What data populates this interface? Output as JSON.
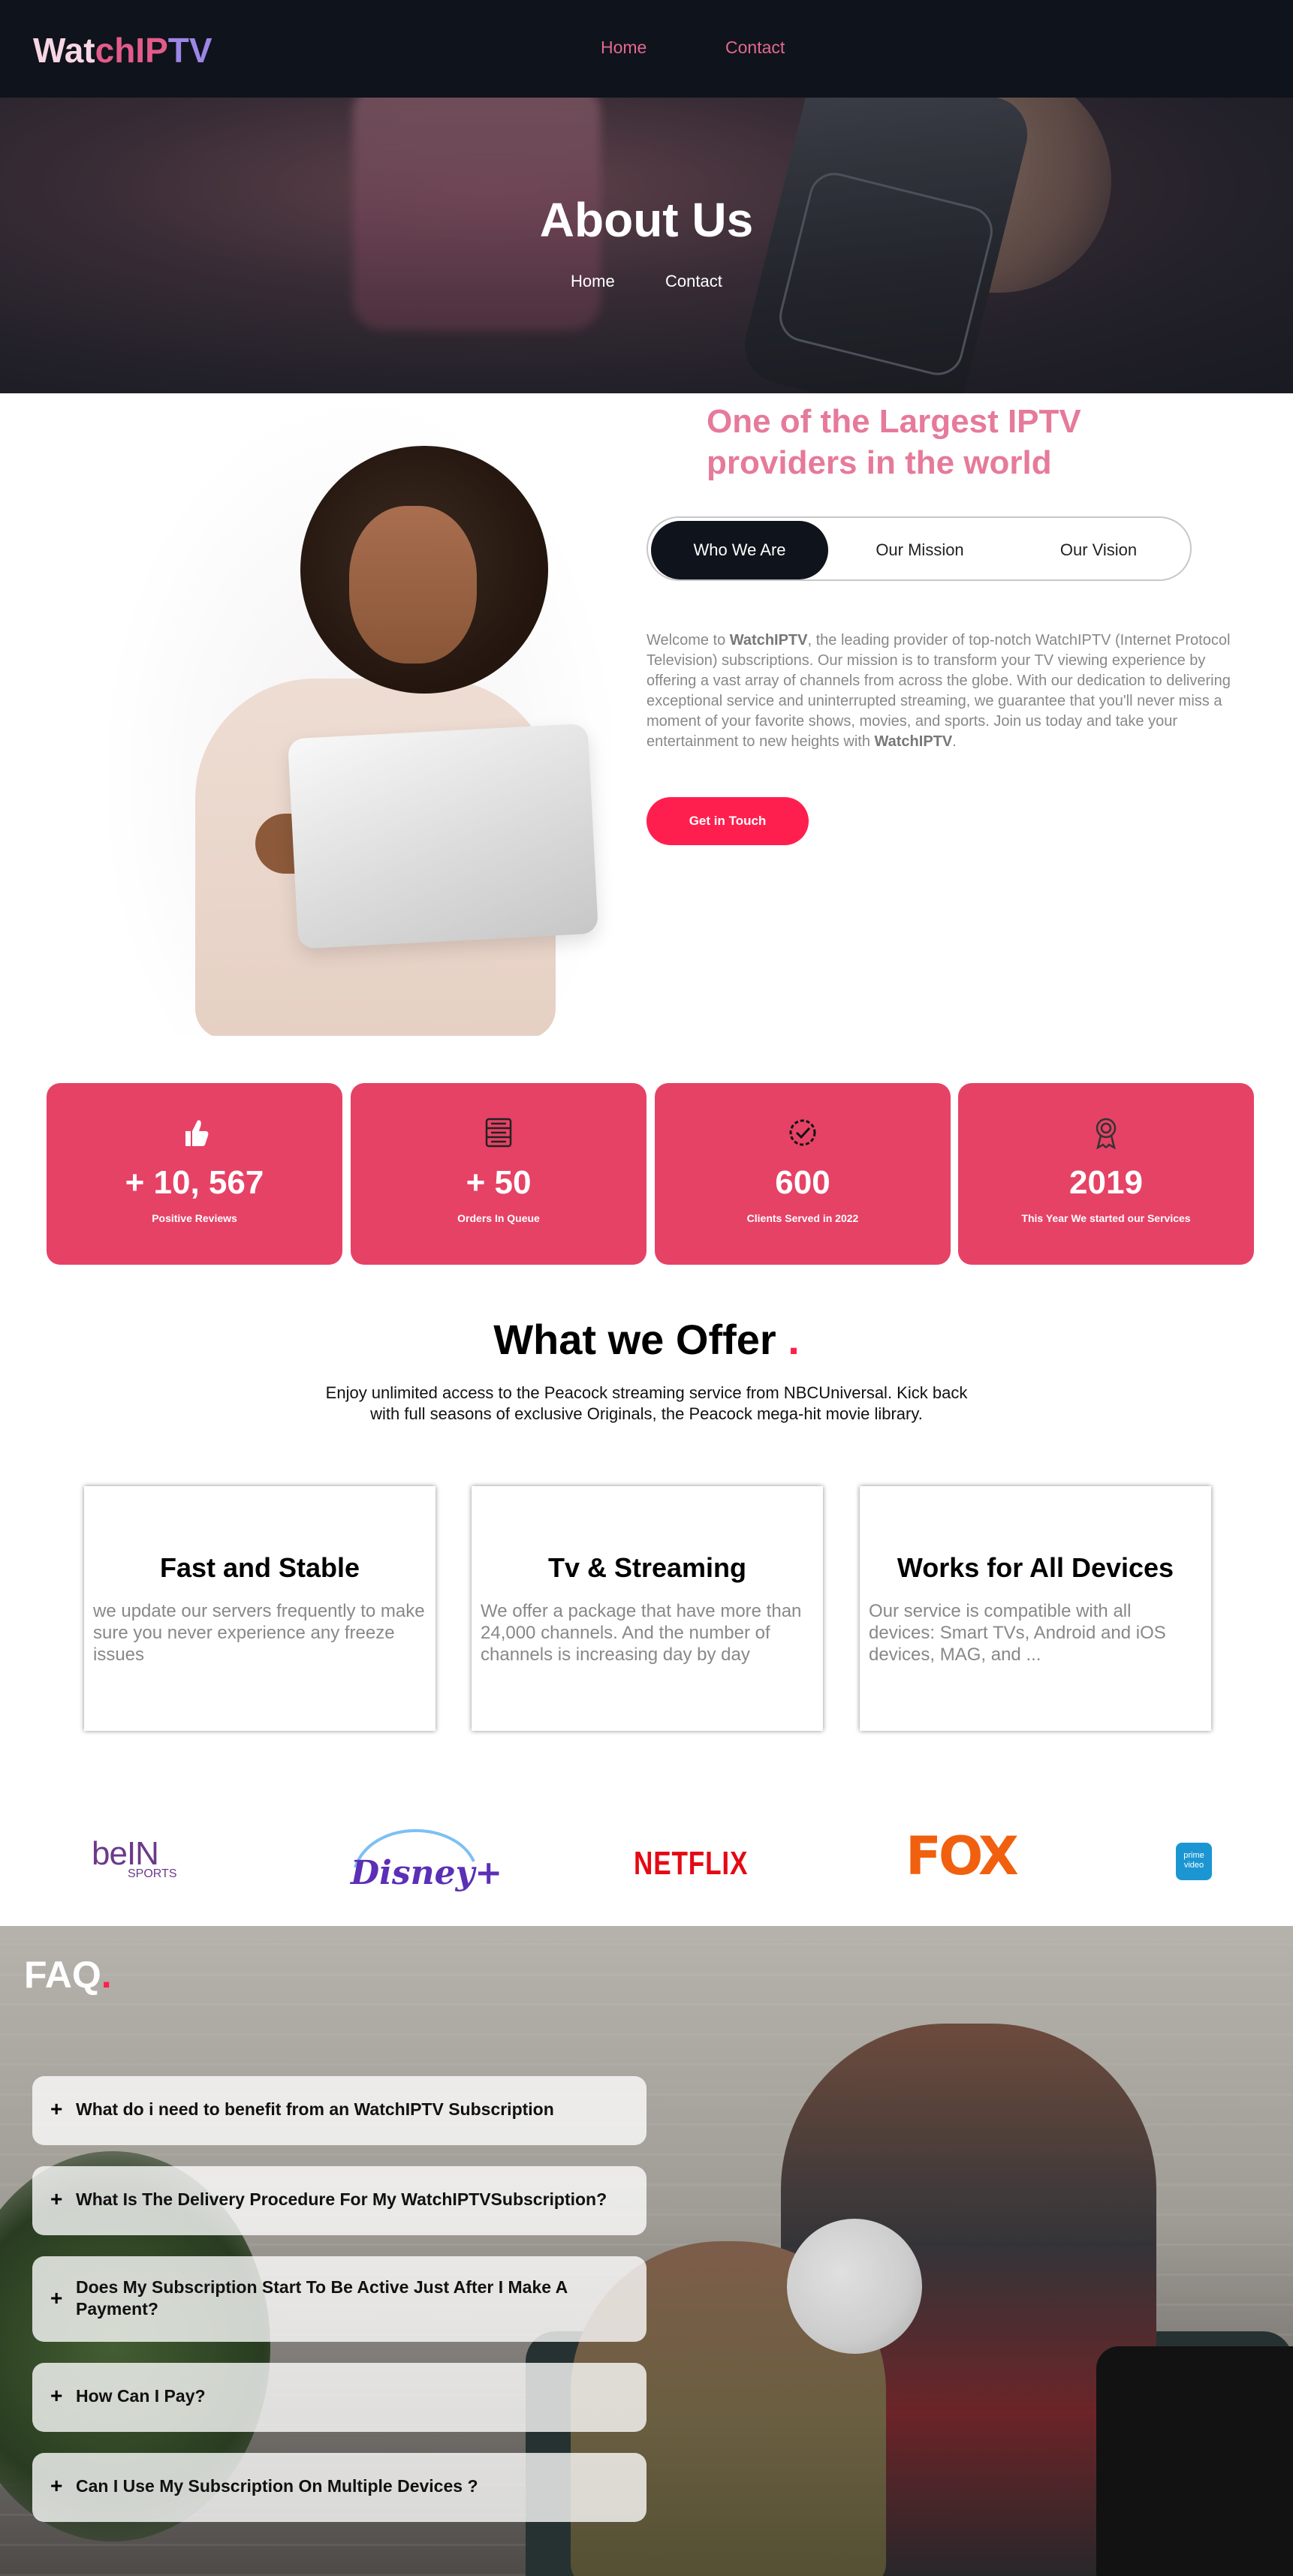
{
  "nav": {
    "logo": {
      "part1": "Wat",
      "part2": "chIP",
      "part3": "TV"
    },
    "links": [
      "Home",
      "Contact"
    ],
    "link_color": "#e3698f"
  },
  "hero": {
    "title": "About Us",
    "links": [
      "Home",
      "Contact"
    ]
  },
  "about": {
    "headline": "One of the Largest IPTV providers in the world",
    "tabs": [
      {
        "label": "Who We Are",
        "active": true
      },
      {
        "label": "Our Mission",
        "active": false
      },
      {
        "label": "Our Vision",
        "active": false
      }
    ],
    "text_pre": "Welcome to ",
    "brand": "WatchIPTV",
    "text_mid": ", the leading provider of top-notch WatchIPTV (Internet Protocol Television) subscriptions. Our mission is to transform your TV viewing experience by offering a vast array of channels from across the globe. With our dedication to delivering exceptional service and uninterrupted streaming, we guarantee that you'll never miss a moment of your favorite shows, movies, and sports. Join us today and take your entertainment to new heights with ",
    "brand_end": "WatchIPTV",
    "text_post": ".",
    "cta": "Get in Touch",
    "accent": "#ff1f4e",
    "headline_color": "#e67a9a"
  },
  "stats": [
    {
      "icon": "thumbs-up-icon",
      "value": "+ 10, 567",
      "label": "Positive Reviews"
    },
    {
      "icon": "server-icon",
      "value": "+ 50",
      "label": "Orders In Queue"
    },
    {
      "icon": "verified-badge-icon",
      "value": "600",
      "label": "Clients Served in 2022"
    },
    {
      "icon": "award-icon",
      "value": "2019",
      "label": "This Year We started our Services"
    }
  ],
  "stats_color": "#e64266",
  "offer": {
    "title": "What we Offer",
    "dot": ".",
    "subtitle": "Enjoy unlimited access to the Peacock streaming service from NBCUniversal. Kick back with full seasons of exclusive Originals, the Peacock mega-hit movie library.",
    "cards": [
      {
        "title": "Fast and Stable",
        "text": "we update our servers frequently to make sure you never experience any freeze issues"
      },
      {
        "title": "Tv & Streaming",
        "text": "We offer a package that have more than 24,000 channels. And the number of channels is increasing day by day"
      },
      {
        "title": "Works for All Devices",
        "text": "Our service is compatible with all devices: Smart TVs, Android and iOS devices, MAG, and ..."
      }
    ]
  },
  "brands": {
    "bein": {
      "main": "beIN",
      "sub": "SPORTS"
    },
    "disney": "Disney+",
    "netflix": "NETFLIX",
    "fox": "FOX",
    "prime": {
      "line1": "prime",
      "line2": "video"
    }
  },
  "faq": {
    "title": "FAQ",
    "dot": ".",
    "questions": [
      "What do i need to benefit from an WatchIPTV Subscription",
      "What Is The Delivery Procedure For My WatchIPTVSubscription?",
      "Does My Subscription Start To Be Active Just After I Make A Payment?",
      "How Can I Pay?",
      "Can I Use My Subscription On Multiple Devices ?"
    ]
  }
}
